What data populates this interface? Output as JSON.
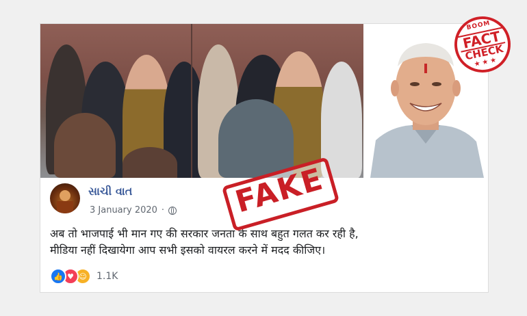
{
  "post": {
    "author": "સાચી વાત",
    "date": "3 January 2020",
    "visibility_icon": "globe-icon",
    "text_lines": [
      "अब तो भाजपाई भी मान गए की सरकार जनता के साथ बहुत गलत कर रही है,",
      "मीडिया नहीं दिखायेगा आप सभी इसको वायरल करने में मदद कीजिए।"
    ],
    "reactions": [
      "like-icon",
      "love-icon",
      "haha-icon"
    ],
    "reaction_count": "1.1K"
  },
  "stamps": {
    "fake": "FAKE",
    "badge_brand": "BOOM",
    "badge_line1": "FACT",
    "badge_line2": "CHECK",
    "badge_stars": "★★★"
  },
  "colors": {
    "stamp_red": "#c91f26",
    "author_blue": "#385898",
    "meta_grey": "#606770"
  }
}
